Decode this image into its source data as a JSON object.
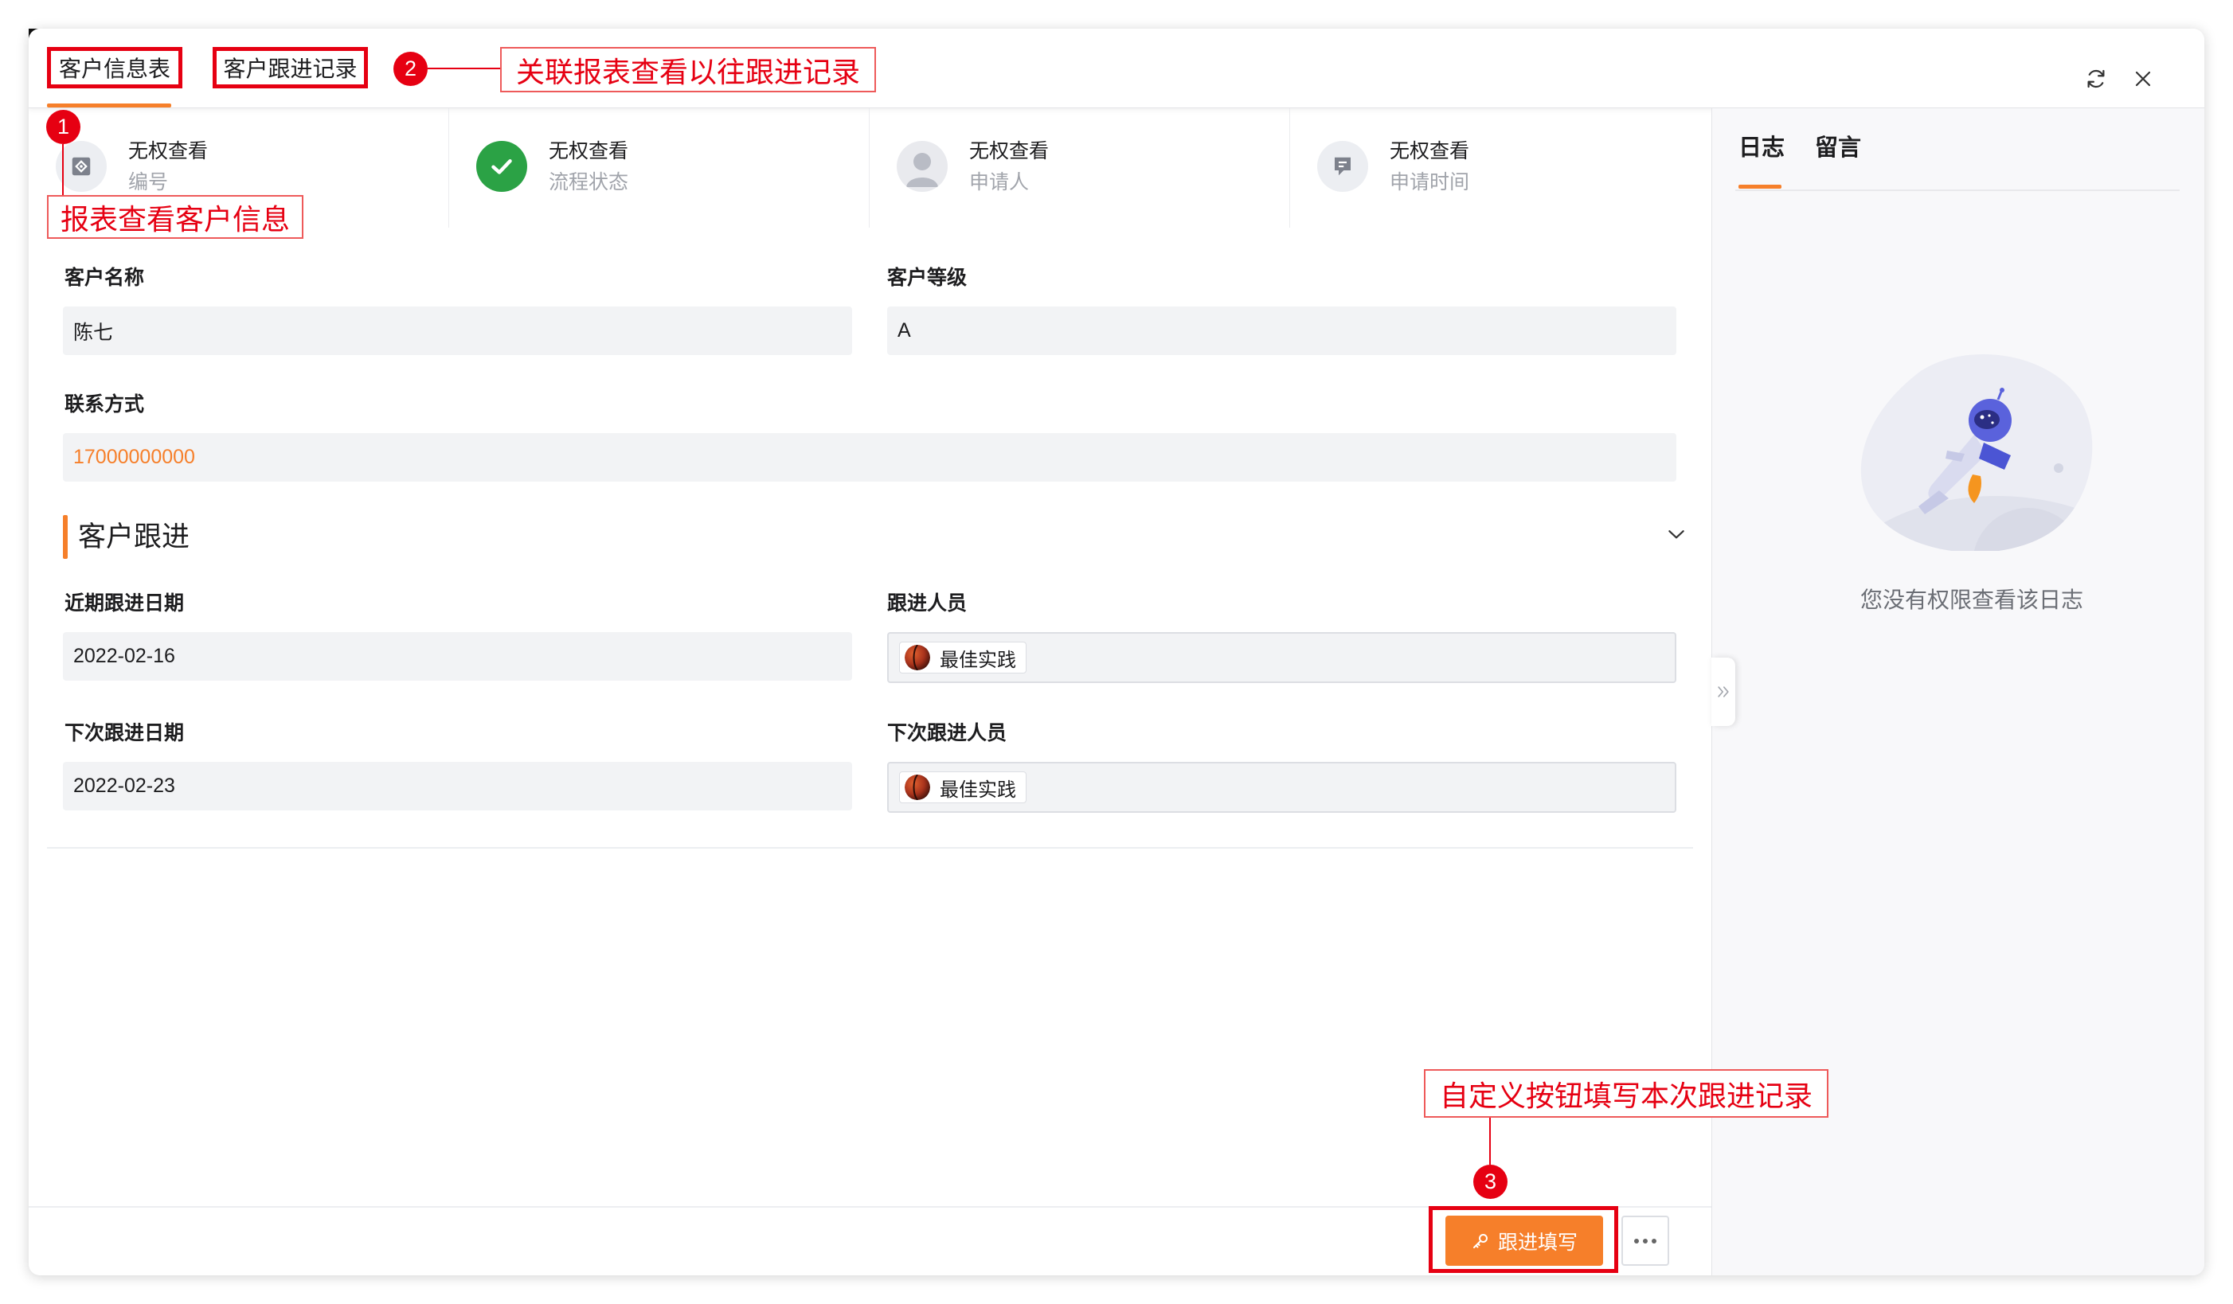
{
  "window": {
    "tabs": [
      {
        "label": "客户信息表"
      },
      {
        "label": "客户跟进记录"
      }
    ],
    "active_tab": 0,
    "actions": {
      "refresh_icon": "refresh-icon",
      "close_icon": "close-icon"
    }
  },
  "annotations": {
    "markers": [
      "1",
      "2",
      "3"
    ],
    "notes": [
      "报表查看客户信息",
      "关联报表查看以往跟进记录",
      "自定义按钮填写本次跟进记录"
    ]
  },
  "process": [
    {
      "value": "无权查看",
      "label": "编号",
      "icon": "serial-number-icon"
    },
    {
      "value": "无权查看",
      "label": "流程状态",
      "icon": "check-circle-icon"
    },
    {
      "value": "无权查看",
      "label": "申请人",
      "icon": "user-avatar-icon"
    },
    {
      "value": "无权查看",
      "label": "申请时间",
      "icon": "time-record-icon"
    }
  ],
  "form": {
    "customer_name": {
      "label": "客户名称",
      "value": "陈七"
    },
    "customer_level": {
      "label": "客户等级",
      "value": "A"
    },
    "contact": {
      "label": "联系方式",
      "value": "17000000000"
    }
  },
  "followup": {
    "title": "客户跟进",
    "collapse_icon": "chevron-down-icon",
    "recent_date": {
      "label": "近期跟进日期",
      "value": "2022-02-16"
    },
    "follower": {
      "label": "跟进人员",
      "value": "最佳实践"
    },
    "next_date": {
      "label": "下次跟进日期",
      "value": "2022-02-23"
    },
    "next_follower": {
      "label": "下次跟进人员",
      "value": "最佳实践"
    }
  },
  "side_panel": {
    "tabs": [
      {
        "label": "日志"
      },
      {
        "label": "留言"
      }
    ],
    "active_tab": 0,
    "empty_text": "您没有权限查看该日志",
    "empty_icon": "astronaut-illustration",
    "expand_icon": "double-chevron-right-icon"
  },
  "footer": {
    "primary_button": {
      "label": "跟进填写",
      "icon": "key-icon"
    },
    "more_icon": "more-icon"
  },
  "colors": {
    "accent": "#f67f2a",
    "success": "#2ba245",
    "annotation": "#e60012",
    "field_bg": "#f2f3f5"
  }
}
